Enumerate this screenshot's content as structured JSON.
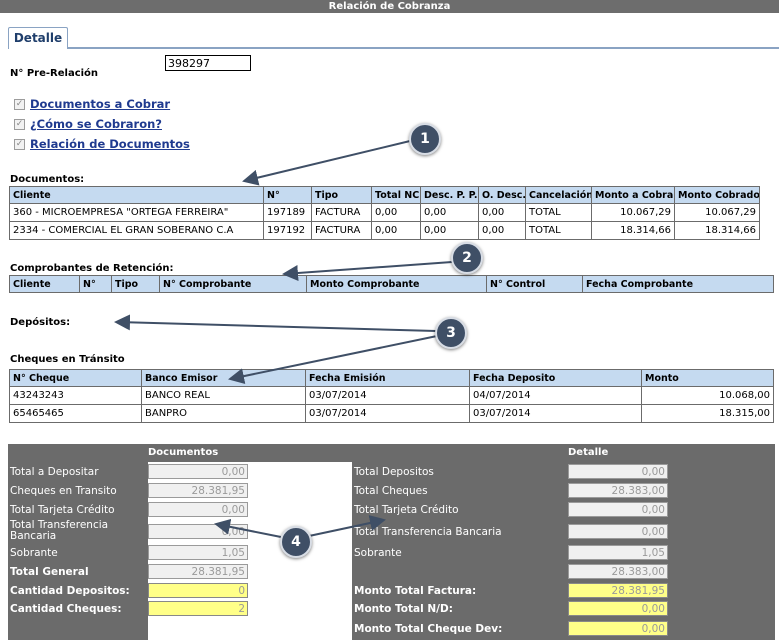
{
  "window": {
    "title": "Relación de Cobranza"
  },
  "tabs": [
    {
      "label": "Detalle"
    }
  ],
  "prerelacion": {
    "label": "N° Pre-Relación",
    "value": "398297"
  },
  "sections": [
    {
      "label": "Documentos a Cobrar",
      "checked": true
    },
    {
      "label": "¿Cómo se Cobraron?",
      "checked": true
    },
    {
      "label": "Relación de Documentos",
      "checked": true
    }
  ],
  "documentos": {
    "title": "Documentos:",
    "columns": [
      "Cliente",
      "N°",
      "Tipo",
      "Total NC",
      "Desc. P. P.",
      "O. Desc.",
      "Cancelación",
      "Monto a Cobrar",
      "Monto Cobrado"
    ],
    "rows": [
      [
        "360 - MICROEMPRESA \"ORTEGA FERREIRA\"",
        "197189",
        "FACTURA",
        "0,00",
        "0,00",
        "0,00",
        "TOTAL",
        "10.067,29",
        "10.067,29"
      ],
      [
        "2334 - COMERCIAL EL GRAN SOBERANO C.A",
        "197192",
        "FACTURA",
        "0,00",
        "0,00",
        "0,00",
        "TOTAL",
        "18.314,66",
        "18.314,66"
      ]
    ]
  },
  "retencion": {
    "title": "Comprobantes de Retención:",
    "columns": [
      "Cliente",
      "N°",
      "Tipo",
      "N° Comprobante",
      "Monto Comprobante",
      "N° Control",
      "Fecha Comprobante"
    ]
  },
  "depositos": {
    "title": "Depósitos:"
  },
  "cheques": {
    "title": "Cheques en Tránsito",
    "columns": [
      "N° Cheque",
      "Banco Emisor",
      "Fecha Emisión",
      "Fecha Deposito",
      "Monto"
    ],
    "rows": [
      [
        "43243243",
        "BANCO REAL",
        "03/07/2014",
        "04/07/2014",
        "10.068,00"
      ],
      [
        "65465465",
        "BANPRO",
        "03/07/2014",
        "03/07/2014",
        "18.315,00"
      ]
    ]
  },
  "summary": {
    "left_header": "Documentos",
    "right_header": "Detalle",
    "left": [
      {
        "label": "Total a Depositar",
        "value": "0,00"
      },
      {
        "label": "Cheques en Transito",
        "value": "28.381,95"
      },
      {
        "label": "Total Tarjeta Crédito",
        "value": "0,00"
      },
      {
        "label": "Total Transferencia Bancaria",
        "value": "0,00"
      },
      {
        "label": "Sobrante",
        "value": "1,05"
      },
      {
        "label": "Total General",
        "value": "28.381,95"
      },
      {
        "label": "Cantidad Depositos:",
        "value": "0"
      },
      {
        "label": "Cantidad Cheques:",
        "value": "2"
      }
    ],
    "right": [
      {
        "label": "Total Depositos",
        "value": "0,00"
      },
      {
        "label": "Total Cheques",
        "value": "28.383,00"
      },
      {
        "label": "Total Tarjeta Crédito",
        "value": "0,00"
      },
      {
        "label": "Total Transferencia Bancaria",
        "value": "0,00"
      },
      {
        "label": "Sobrante",
        "value": "1,05"
      },
      {
        "label": "",
        "value": "28.383,00"
      },
      {
        "label": "Monto Total Factura:",
        "value": "28.381,95"
      },
      {
        "label": "Monto Total N/D:",
        "value": "0,00"
      },
      {
        "label": "Monto Total Cheque Dev:",
        "value": "0,00"
      }
    ]
  },
  "callouts": [
    "1",
    "2",
    "3",
    "4"
  ],
  "icons": {
    "checkbox": "checkmark-icon"
  },
  "colors": {
    "titlebar": "#6d6d6d",
    "header_row": "#c5daf0",
    "link": "#1f3a8f",
    "highlight": "#ffff88",
    "callout": "#3f4f66"
  }
}
